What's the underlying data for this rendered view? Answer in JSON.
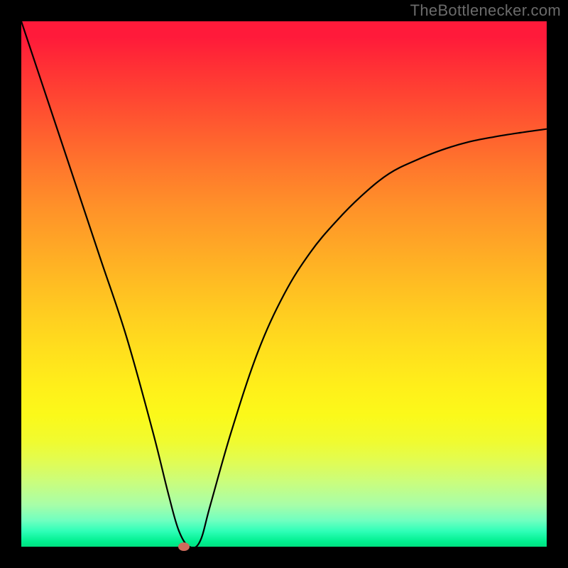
{
  "watermark": "TheBottlenecker.com",
  "chart_data": {
    "type": "line",
    "title": "",
    "xlabel": "",
    "ylabel": "",
    "xlim": [
      0,
      100
    ],
    "ylim": [
      0,
      100
    ],
    "background_gradient": {
      "top_color": "#ff1a3a",
      "mid_color": "#ffd020",
      "bottom_color": "#00e080",
      "note": "red at top (high bottleneck) through yellow to green at bottom (low bottleneck)"
    },
    "series": [
      {
        "name": "bottleneck-curve",
        "x": [
          0,
          5,
          10,
          15,
          20,
          25,
          28,
          30,
          32,
          34,
          36,
          40,
          45,
          50,
          55,
          60,
          65,
          70,
          75,
          80,
          85,
          90,
          95,
          100
        ],
        "y_pct": [
          100,
          85,
          70,
          55,
          40,
          22,
          10,
          3,
          0,
          1,
          8,
          22,
          37,
          48,
          56,
          62,
          67,
          71,
          73.5,
          75.5,
          77,
          78,
          78.8,
          79.5
        ],
        "note": "y_pct is percentage of vertical range from bottom (0) to top (100); curve drops sharply from top-left to near-zero around x≈31 then rises asymptotically toward ~80%"
      }
    ],
    "marker": {
      "name": "optimum-point",
      "x": 31,
      "y_pct": 0,
      "color": "#ce6b5c"
    },
    "annotations": []
  }
}
